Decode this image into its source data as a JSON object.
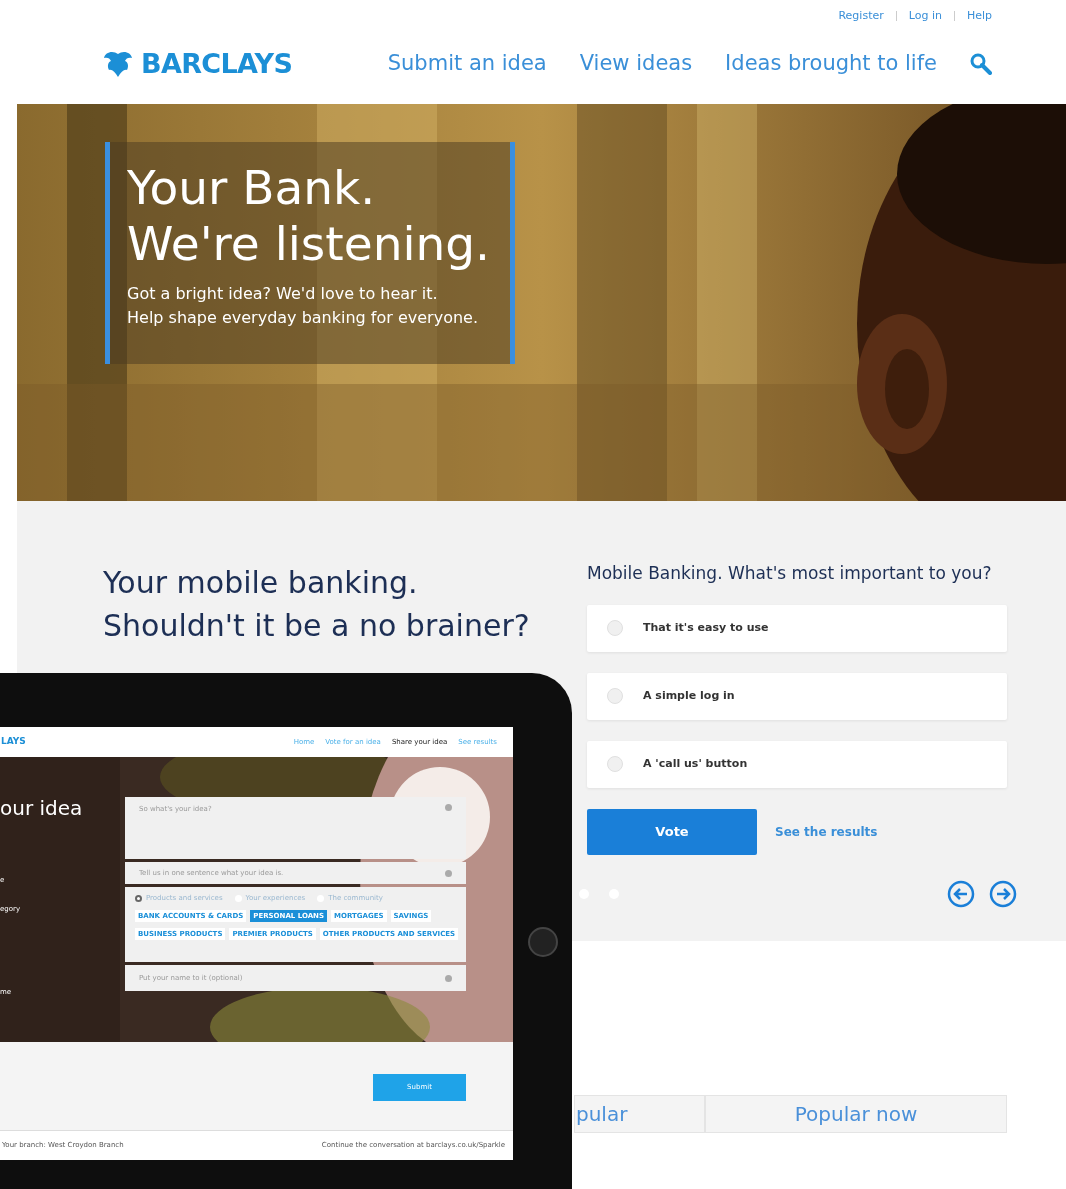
{
  "top_links": [
    "Register",
    "Log in",
    "Help"
  ],
  "header": {
    "logo": "BARCLAYS",
    "nav": [
      "Submit an idea",
      "View ideas",
      "Ideas brought to life"
    ]
  },
  "hero": {
    "title_lines": [
      "Your Bank.",
      "We're listening."
    ],
    "subtitle_lines": [
      "Got a bright idea? We'd love to hear it.",
      "Help shape everyday banking for everyone."
    ]
  },
  "promo": {
    "heading_lines": [
      "Your mobile banking.",
      "Shouldn't it be a no brainer?"
    ]
  },
  "poll": {
    "question": "Mobile Banking. What's most important to you?",
    "options": [
      {
        "label": "That it's easy to use",
        "selected": false
      },
      {
        "label": "A simple log in",
        "selected": false
      },
      {
        "label": "A 'call us' button",
        "selected": false
      }
    ],
    "vote_button": "Vote",
    "results_link": "See the results"
  },
  "tabs": [
    {
      "label": "pular"
    },
    {
      "label": "Popular now"
    }
  ],
  "tablet": {
    "logo": "LAYS",
    "nav": [
      {
        "label": "Home",
        "selected": false
      },
      {
        "label": "Vote for an idea",
        "selected": false
      },
      {
        "label": "Share your idea",
        "selected": true
      },
      {
        "label": "See results",
        "selected": false
      }
    ],
    "heading": "our idea",
    "side_labels": [
      "e",
      "egory",
      "me"
    ],
    "idea_placeholder": "So what's your idea?",
    "sentence_placeholder": "Tell us in one sentence what your idea is.",
    "categories": [
      {
        "label": "Products and services",
        "selected": true
      },
      {
        "label": "Your experiences",
        "selected": false
      },
      {
        "label": "The community",
        "selected": false
      }
    ],
    "tags": [
      {
        "label": "BANK ACCOUNTS & CARDS",
        "selected": false
      },
      {
        "label": "PERSONAL LOANS",
        "selected": true
      },
      {
        "label": "MORTGAGES",
        "selected": false
      },
      {
        "label": "SAVINGS",
        "selected": false
      },
      {
        "label": "BUSINESS PRODUCTS",
        "selected": false
      },
      {
        "label": "PREMIER PRODUCTS",
        "selected": false
      },
      {
        "label": "OTHER PRODUCTS AND SERVICES",
        "selected": false
      }
    ],
    "name_placeholder": "Put your name to it (optional)",
    "submit": "Submit",
    "footer_left": "Your branch: West Croydon Branch",
    "footer_right": "Continue the conversation at barclays.co.uk/Sparkle"
  }
}
